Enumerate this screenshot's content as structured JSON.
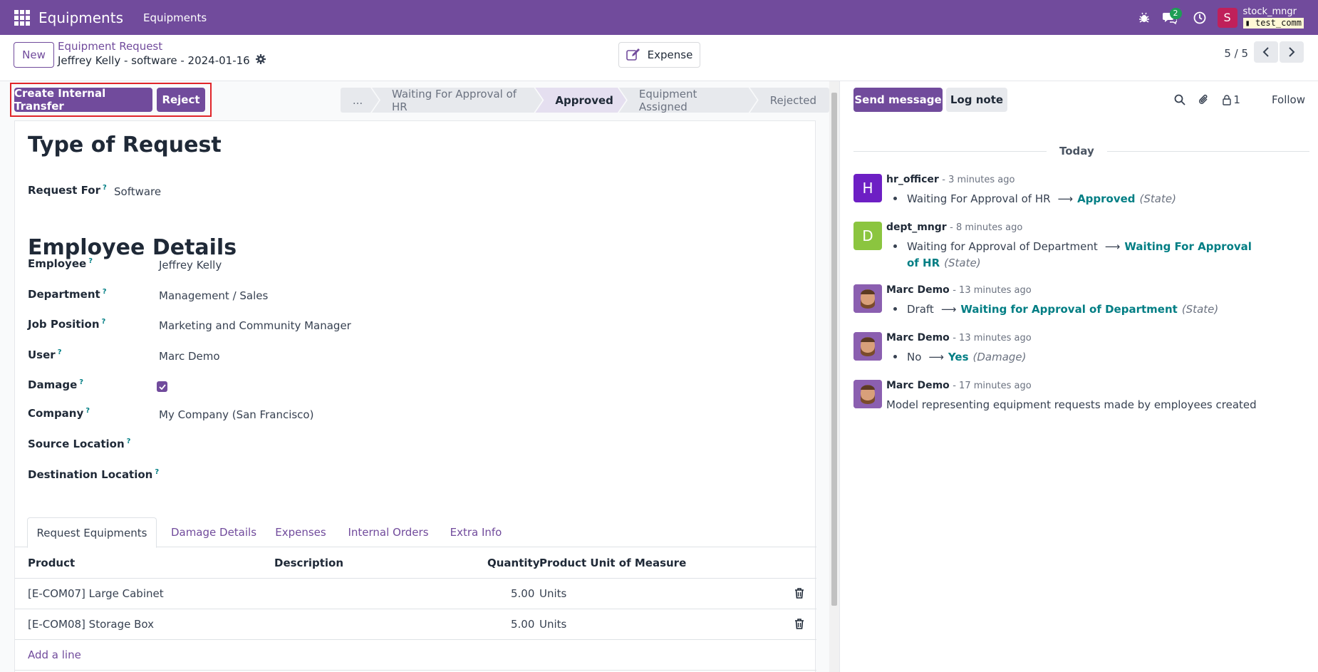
{
  "navbar": {
    "app_name": "Equipments",
    "menu_item": "Equipments",
    "chat_count": "2",
    "avatar_letter": "S",
    "user_name": "stock_mngr",
    "db_name": "test_comm"
  },
  "control": {
    "new_label": "New",
    "breadcrumb": "Equipment Request",
    "record_name": "Jeffrey Kelly - software - 2024-01-16",
    "expense_label": "Expense",
    "pager": "5 / 5"
  },
  "statusbar": {
    "buttons": [
      "Create Internal Transfer",
      "Reject"
    ],
    "stages": [
      "...",
      "Waiting For Approval of HR",
      "Approved",
      "Equipment Assigned",
      "Rejected"
    ],
    "active_stage": "Approved"
  },
  "form": {
    "section1_title": "Type of Request",
    "request_for_label": "Request For",
    "request_for_value": "Software",
    "section2_title": "Employee Details",
    "fields": [
      {
        "label": "Employee",
        "value": "Jeffrey Kelly"
      },
      {
        "label": "Department",
        "value": "Management / Sales"
      },
      {
        "label": "Job Position",
        "value": "Marketing and Community Manager"
      },
      {
        "label": "User",
        "value": "Marc Demo"
      },
      {
        "label": "Damage",
        "value": ""
      },
      {
        "label": "Company",
        "value": "My Company (San Francisco)"
      },
      {
        "label": "Source Location",
        "value": ""
      },
      {
        "label": "Destination Location",
        "value": ""
      }
    ],
    "damage_checked": true,
    "help_mark": "?",
    "tabs": [
      "Request Equipments",
      "Damage Details",
      "Expenses",
      "Internal Orders",
      "Extra Info"
    ],
    "table": {
      "headers": [
        "Product",
        "Description",
        "Quantity",
        "Product Unit of Measure"
      ],
      "rows": [
        {
          "product": "[E-COM07] Large Cabinet",
          "description": "",
          "quantity": "5.00",
          "uom": "Units"
        },
        {
          "product": "[E-COM08] Storage Box",
          "description": "",
          "quantity": "5.00",
          "uom": "Units"
        }
      ],
      "add_line": "Add a line"
    }
  },
  "chatter": {
    "send_message": "Send message",
    "log_note": "Log note",
    "followers_count": "1",
    "follow": "Follow",
    "today": "Today",
    "messages": [
      {
        "author": "hr_officer",
        "time": "- 3 minutes ago",
        "avatar": "H",
        "avatar_color": "#6d1fc4",
        "old": "Waiting For Approval of HR",
        "new": "Approved",
        "field": "(State)"
      },
      {
        "author": "dept_mngr",
        "time": "- 8 minutes ago",
        "avatar": "D",
        "avatar_color": "#8bc53f",
        "old": "Waiting for Approval of Department",
        "new": "Waiting For Approval of HR",
        "field": "(State)"
      },
      {
        "author": "Marc Demo",
        "time": "- 13 minutes ago",
        "avatar": "",
        "avatar_color": "#8b5fb0",
        "old": "Draft",
        "new": "Waiting for Approval of Department",
        "field": "(State)"
      },
      {
        "author": "Marc Demo",
        "time": "- 13 minutes ago",
        "avatar": "",
        "avatar_color": "#8b5fb0",
        "old": "No",
        "new": "Yes",
        "field": "(Damage)"
      },
      {
        "author": "Marc Demo",
        "time": "- 17 minutes ago",
        "avatar": "",
        "avatar_color": "#8b5fb0",
        "text": "Model representing equipment requests made by employees created"
      }
    ]
  }
}
